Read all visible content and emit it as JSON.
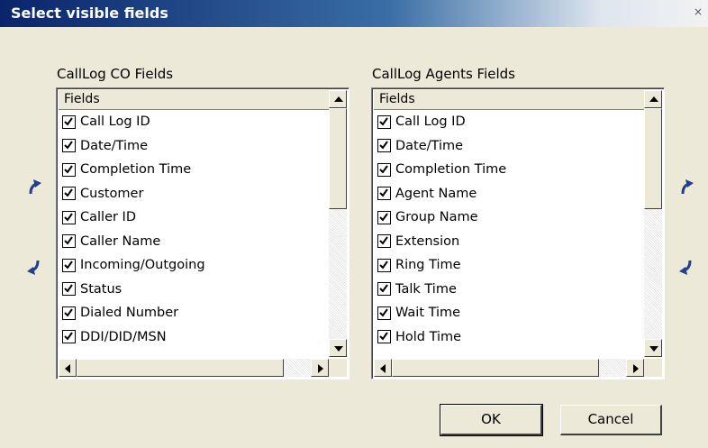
{
  "dialog": {
    "title": "Select visible fields",
    "close_glyph": "×"
  },
  "left_panel": {
    "label": "CallLog CO Fields",
    "column_header": "Fields",
    "items": [
      {
        "label": "Call Log ID",
        "checked": true
      },
      {
        "label": "Date/Time",
        "checked": true
      },
      {
        "label": "Completion Time",
        "checked": true
      },
      {
        "label": "Customer",
        "checked": true
      },
      {
        "label": "Caller ID",
        "checked": true
      },
      {
        "label": "Caller Name",
        "checked": true
      },
      {
        "label": "Incoming/Outgoing",
        "checked": true
      },
      {
        "label": "Status",
        "checked": true
      },
      {
        "label": "Dialed Number",
        "checked": true
      },
      {
        "label": "DDI/DID/MSN",
        "checked": true
      }
    ]
  },
  "right_panel": {
    "label": "CallLog Agents Fields",
    "column_header": "Fields",
    "items": [
      {
        "label": "Call Log ID",
        "checked": true
      },
      {
        "label": "Date/Time",
        "checked": true
      },
      {
        "label": "Completion Time",
        "checked": true
      },
      {
        "label": "Agent Name",
        "checked": true
      },
      {
        "label": "Group Name",
        "checked": true
      },
      {
        "label": "Extension",
        "checked": true
      },
      {
        "label": "Ring Time",
        "checked": true
      },
      {
        "label": "Talk Time",
        "checked": true
      },
      {
        "label": "Wait Time",
        "checked": true
      },
      {
        "label": "Hold Time",
        "checked": true
      }
    ]
  },
  "buttons": {
    "ok": "OK",
    "cancel": "Cancel"
  },
  "icons": {
    "move_up": "curved-arrow-up-icon",
    "move_down": "curved-arrow-down-icon"
  },
  "colors": {
    "arrow": "#1f3f8f",
    "face": "#ece9d8",
    "title_start": "#0a246a"
  }
}
